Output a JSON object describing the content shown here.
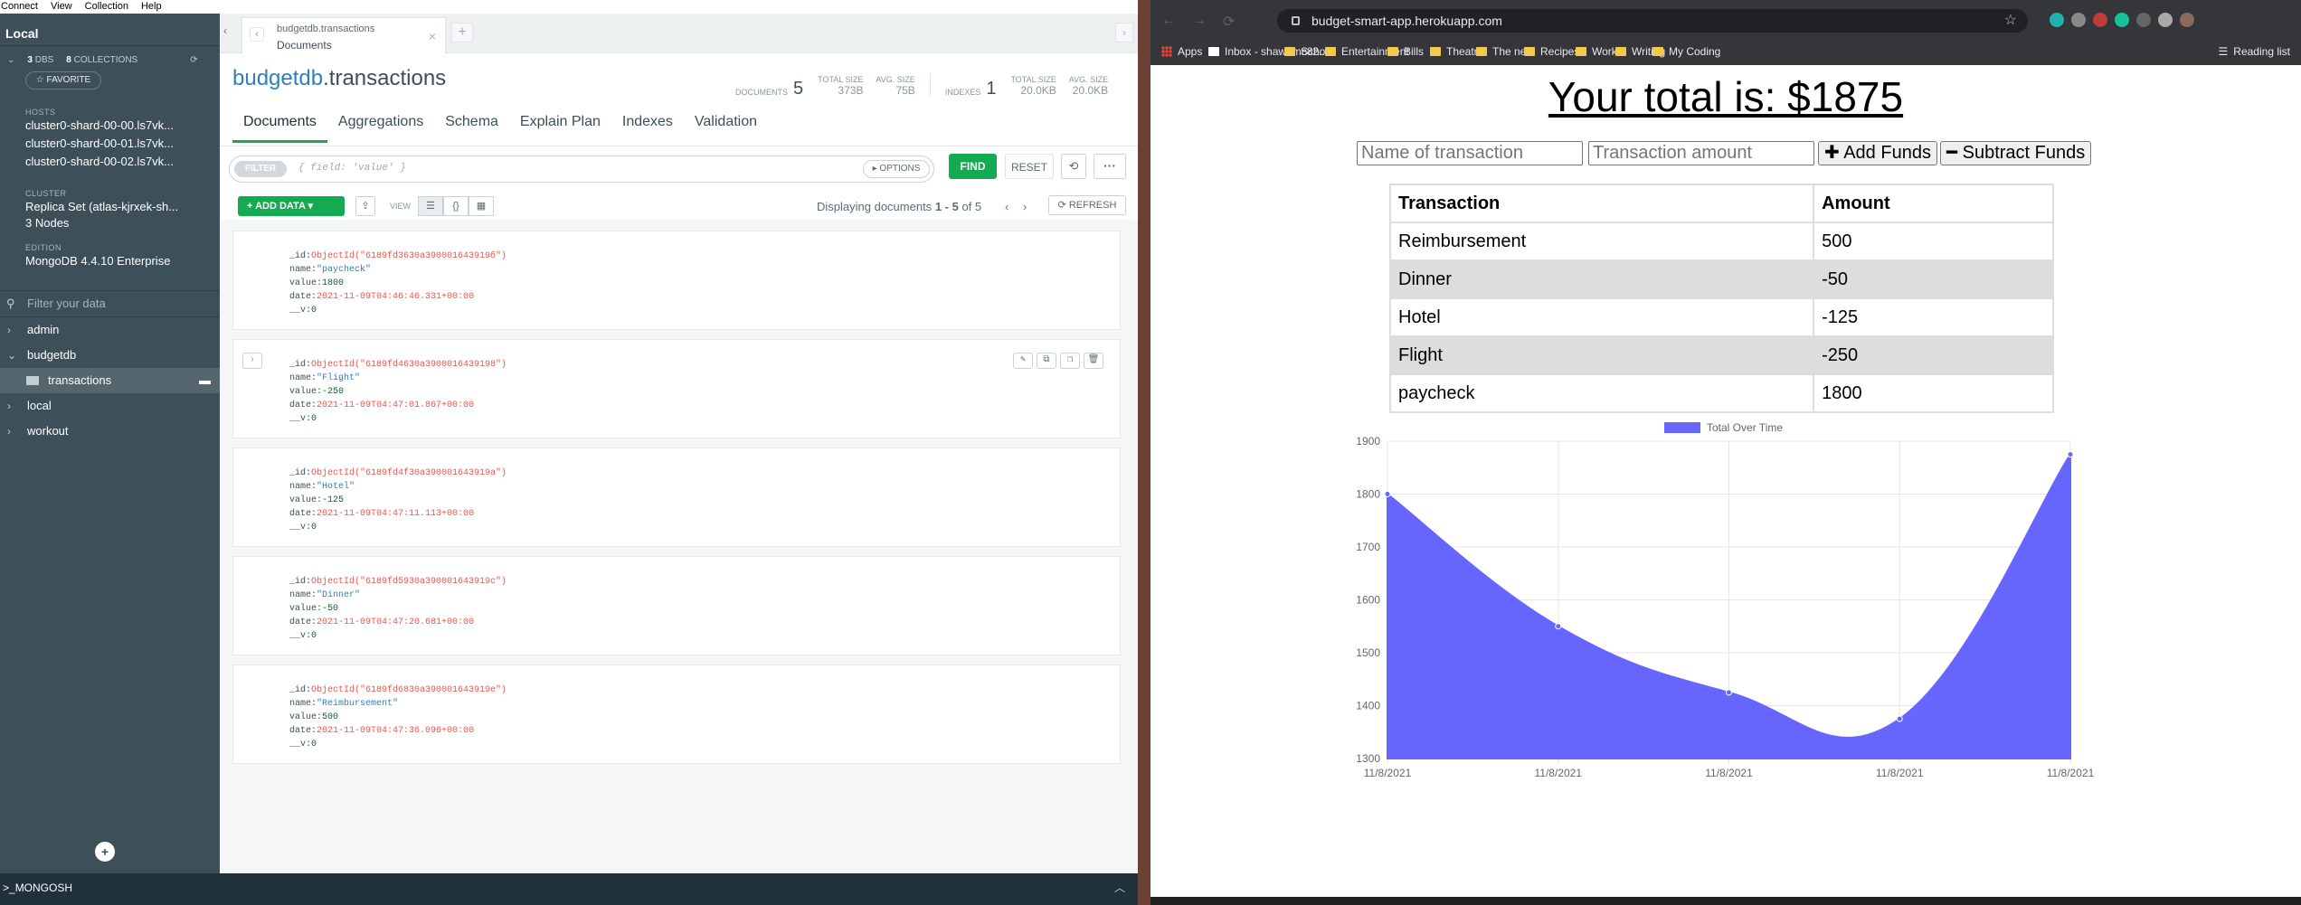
{
  "menubar": [
    "Connect",
    "View",
    "Collection",
    "Help"
  ],
  "sidebar": {
    "title": "Local",
    "dbs_count": "3",
    "dbs_label": "DBS",
    "collections_count": "8",
    "collections_label": "COLLECTIONS",
    "favorite": "☆ FAVORITE",
    "hosts_label": "HOSTS",
    "hosts": [
      "cluster0-shard-00-00.ls7vk...",
      "cluster0-shard-00-01.ls7vk...",
      "cluster0-shard-00-02.ls7vk..."
    ],
    "cluster_label": "CLUSTER",
    "cluster": [
      "Replica Set (atlas-kjrxek-sh...",
      "3 Nodes"
    ],
    "edition_label": "EDITION",
    "edition": "MongoDB 4.4.10 Enterprise",
    "filter_placeholder": "Filter your data",
    "databases": [
      "admin",
      "budgetdb",
      "local",
      "workout"
    ],
    "selected_collection": "transactions",
    "add_icon": "plus-icon"
  },
  "mongosh": "_MONGOSH",
  "tab": {
    "line1": "budgetdb.transactions",
    "line2": "Documents"
  },
  "header": {
    "db": "budgetdb",
    "coll": ".transactions",
    "documents_label": "DOCUMENTS",
    "documents_count": "5",
    "total_size_label": "TOTAL SIZE",
    "total_size": "373B",
    "avg_size_label": "AVG. SIZE",
    "avg_size": "75B",
    "indexes_label": "INDEXES",
    "indexes_count": "1",
    "idx_total_size": "20.0KB",
    "idx_avg_size": "20.0KB"
  },
  "navtabs": [
    "Documents",
    "Aggregations",
    "Schema",
    "Explain Plan",
    "Indexes",
    "Validation"
  ],
  "filter": {
    "pill": "FILTER",
    "placeholder": "{ field: 'value' }",
    "options": "▸ OPTIONS",
    "find": "FIND",
    "reset": "RESET"
  },
  "toolbar": {
    "add_data": "ADD DATA",
    "view": "VIEW",
    "displaying": "Displaying documents",
    "range": "1 - 5",
    "of": "of 5",
    "refresh": "REFRESH"
  },
  "documents": [
    {
      "id": "ObjectId(\"6189fd3630a390001643919б\")",
      "name": "\"paycheck\"",
      "value": "1800",
      "date": "2021-11-09T04:46:46.331+00:00",
      "v": "0"
    },
    {
      "id": "ObjectId(\"6189fd4630a3900016439198\")",
      "name": "\"Flight\"",
      "value": "-250",
      "date": "2021-11-09T04:47:01.867+00:00",
      "v": "0"
    },
    {
      "id": "ObjectId(\"6189fd4f30a390001643919a\")",
      "name": "\"Hotel\"",
      "value": "-125",
      "date": "2021-11-09T04:47:11.113+00:00",
      "v": "0"
    },
    {
      "id": "ObjectId(\"6189fd5930a390001643919c\")",
      "name": "\"Dinner\"",
      "value": "-50",
      "date": "2021-11-09T04:47:20.681+00:00",
      "v": "0"
    },
    {
      "id": "ObjectId(\"6189fd6830a390001643919e\")",
      "name": "\"Reimbursement\"",
      "value": "500",
      "date": "2021-11-09T04:47:36.096+00:00",
      "v": "0"
    }
  ],
  "doc_keys": {
    "id": "_id:",
    "name": "name:",
    "value": "value:",
    "date": "date:",
    "v": "__v:"
  },
  "browser": {
    "url": "budget-smart-app.herokuapp.com",
    "bookmarks": [
      "Apps",
      "Inbox - shawnmc82...",
      "School",
      "Entertainment",
      "Bills",
      "Theatre",
      "The nets",
      "Recipes",
      "Work",
      "Writing",
      "My Coding"
    ],
    "reading_list": "Reading list"
  },
  "app": {
    "total": "Your total is: $1875",
    "name_placeholder": "Name of transaction",
    "amount_placeholder": "Transaction amount",
    "add_btn": "Add Funds",
    "sub_btn": "Subtract Funds",
    "table_headers": [
      "Transaction",
      "Amount"
    ],
    "rows": [
      [
        "Reimbursement",
        "500"
      ],
      [
        "Dinner",
        "-50"
      ],
      [
        "Hotel",
        "-125"
      ],
      [
        "Flight",
        "-250"
      ],
      [
        "paycheck",
        "1800"
      ]
    ]
  },
  "chart_data": {
    "type": "area",
    "legend": "Total Over Time",
    "legend_position": "top",
    "x": [
      "11/8/2021",
      "11/8/2021",
      "11/8/2021",
      "11/8/2021",
      "11/8/2021"
    ],
    "values": [
      1800,
      1550,
      1425,
      1375,
      1875
    ],
    "ylim": [
      1300,
      1900
    ],
    "yticks": [
      1300,
      1400,
      1500,
      1600,
      1700,
      1800,
      1900
    ],
    "grid": true,
    "color": "#6666ff"
  }
}
